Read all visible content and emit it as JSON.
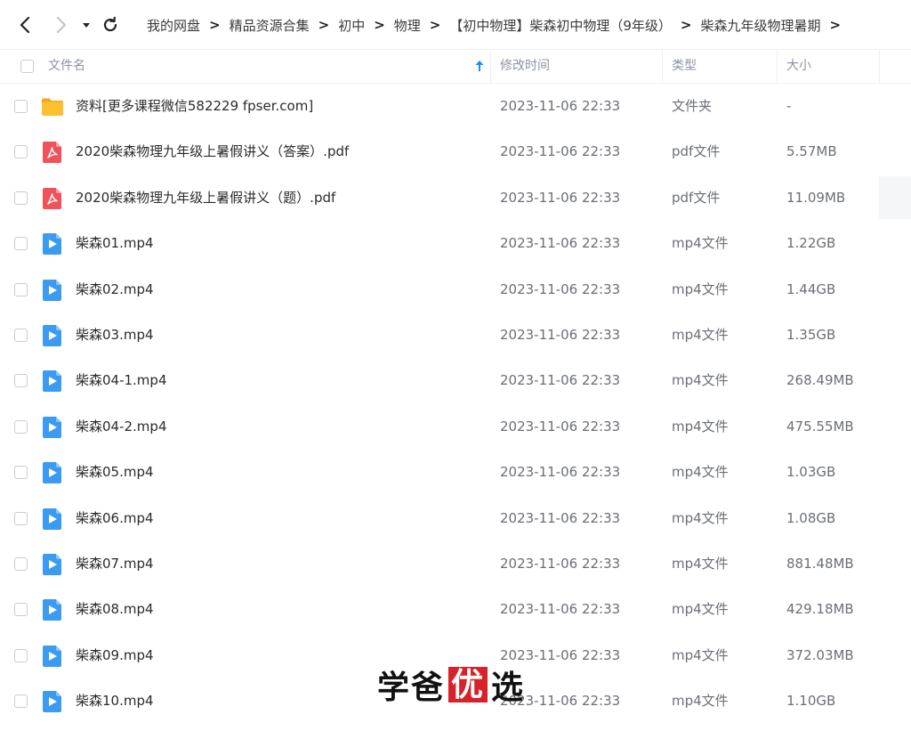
{
  "nav": {
    "breadcrumbs": [
      "我的网盘",
      "精品资源合集",
      "初中",
      "物理",
      "【初中物理】柴森初中物理（9年级）",
      "柴森九年级物理暑期"
    ],
    "separator": ">"
  },
  "columns": {
    "name": "文件名",
    "time": "修改时间",
    "type": "类型",
    "size": "大小"
  },
  "files": [
    {
      "name": "资料[更多课程微信582229 fpser.com]",
      "time": "2023-11-06 22:33",
      "type": "文件夹",
      "size": "-",
      "icon": "folder"
    },
    {
      "name": "2020柴森物理九年级上暑假讲义（答案）.pdf",
      "time": "2023-11-06 22:33",
      "type": "pdf文件",
      "size": "5.57MB",
      "icon": "pdf"
    },
    {
      "name": "2020柴森物理九年级上暑假讲义（题）.pdf",
      "time": "2023-11-06 22:33",
      "type": "pdf文件",
      "size": "11.09MB",
      "icon": "pdf"
    },
    {
      "name": "柴森01.mp4",
      "time": "2023-11-06 22:33",
      "type": "mp4文件",
      "size": "1.22GB",
      "icon": "video"
    },
    {
      "name": "柴森02.mp4",
      "time": "2023-11-06 22:33",
      "type": "mp4文件",
      "size": "1.44GB",
      "icon": "video"
    },
    {
      "name": "柴森03.mp4",
      "time": "2023-11-06 22:33",
      "type": "mp4文件",
      "size": "1.35GB",
      "icon": "video"
    },
    {
      "name": "柴森04-1.mp4",
      "time": "2023-11-06 22:33",
      "type": "mp4文件",
      "size": "268.49MB",
      "icon": "video"
    },
    {
      "name": "柴森04-2.mp4",
      "time": "2023-11-06 22:33",
      "type": "mp4文件",
      "size": "475.55MB",
      "icon": "video"
    },
    {
      "name": "柴森05.mp4",
      "time": "2023-11-06 22:33",
      "type": "mp4文件",
      "size": "1.03GB",
      "icon": "video"
    },
    {
      "name": "柴森06.mp4",
      "time": "2023-11-06 22:33",
      "type": "mp4文件",
      "size": "1.08GB",
      "icon": "video"
    },
    {
      "name": "柴森07.mp4",
      "time": "2023-11-06 22:33",
      "type": "mp4文件",
      "size": "881.48MB",
      "icon": "video"
    },
    {
      "name": "柴森08.mp4",
      "time": "2023-11-06 22:33",
      "type": "mp4文件",
      "size": "429.18MB",
      "icon": "video"
    },
    {
      "name": "柴森09.mp4",
      "time": "2023-11-06 22:33",
      "type": "mp4文件",
      "size": "372.03MB",
      "icon": "video"
    },
    {
      "name": "柴森10.mp4",
      "time": "2023-11-06 22:33",
      "type": "mp4文件",
      "size": "1.10GB",
      "icon": "video"
    }
  ],
  "watermark": {
    "part1": "学爸",
    "highlight": "优",
    "part2": "选"
  },
  "colors": {
    "accent": "#1a8cff",
    "pdf": "#f0525a",
    "video": "#3a9bf0",
    "folder": "#fdc12f",
    "watermark_red": "#d8222a"
  }
}
